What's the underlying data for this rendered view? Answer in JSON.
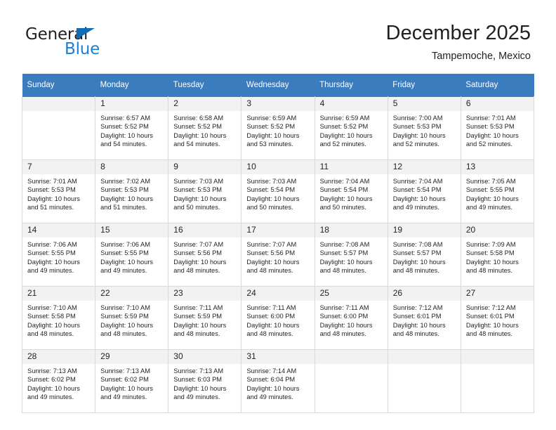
{
  "logo": {
    "word_one": "General",
    "word_two": "Blue",
    "triangle_color": "#0f6cb6",
    "blue_text_color": "#1b7fd4"
  },
  "header": {
    "title": "December 2025",
    "subtitle": "Tampemoche, Mexico"
  },
  "theme": {
    "header_blue": "#3a7cbe",
    "daynum_gray": "#f2f2f2",
    "border_gray": "#d9d9d9",
    "text": "#231f20"
  },
  "weekday_headers": [
    "Sunday",
    "Monday",
    "Tuesday",
    "Wednesday",
    "Thursday",
    "Friday",
    "Saturday"
  ],
  "weeks": [
    [
      {
        "day": "",
        "sunrise": "",
        "sunset": "",
        "daylight_line1": "",
        "daylight_line2": ""
      },
      {
        "day": "1",
        "sunrise": "Sunrise: 6:57 AM",
        "sunset": "Sunset: 5:52 PM",
        "daylight_line1": "Daylight: 10 hours",
        "daylight_line2": "and 54 minutes."
      },
      {
        "day": "2",
        "sunrise": "Sunrise: 6:58 AM",
        "sunset": "Sunset: 5:52 PM",
        "daylight_line1": "Daylight: 10 hours",
        "daylight_line2": "and 54 minutes."
      },
      {
        "day": "3",
        "sunrise": "Sunrise: 6:59 AM",
        "sunset": "Sunset: 5:52 PM",
        "daylight_line1": "Daylight: 10 hours",
        "daylight_line2": "and 53 minutes."
      },
      {
        "day": "4",
        "sunrise": "Sunrise: 6:59 AM",
        "sunset": "Sunset: 5:52 PM",
        "daylight_line1": "Daylight: 10 hours",
        "daylight_line2": "and 52 minutes."
      },
      {
        "day": "5",
        "sunrise": "Sunrise: 7:00 AM",
        "sunset": "Sunset: 5:53 PM",
        "daylight_line1": "Daylight: 10 hours",
        "daylight_line2": "and 52 minutes."
      },
      {
        "day": "6",
        "sunrise": "Sunrise: 7:01 AM",
        "sunset": "Sunset: 5:53 PM",
        "daylight_line1": "Daylight: 10 hours",
        "daylight_line2": "and 52 minutes."
      }
    ],
    [
      {
        "day": "7",
        "sunrise": "Sunrise: 7:01 AM",
        "sunset": "Sunset: 5:53 PM",
        "daylight_line1": "Daylight: 10 hours",
        "daylight_line2": "and 51 minutes."
      },
      {
        "day": "8",
        "sunrise": "Sunrise: 7:02 AM",
        "sunset": "Sunset: 5:53 PM",
        "daylight_line1": "Daylight: 10 hours",
        "daylight_line2": "and 51 minutes."
      },
      {
        "day": "9",
        "sunrise": "Sunrise: 7:03 AM",
        "sunset": "Sunset: 5:53 PM",
        "daylight_line1": "Daylight: 10 hours",
        "daylight_line2": "and 50 minutes."
      },
      {
        "day": "10",
        "sunrise": "Sunrise: 7:03 AM",
        "sunset": "Sunset: 5:54 PM",
        "daylight_line1": "Daylight: 10 hours",
        "daylight_line2": "and 50 minutes."
      },
      {
        "day": "11",
        "sunrise": "Sunrise: 7:04 AM",
        "sunset": "Sunset: 5:54 PM",
        "daylight_line1": "Daylight: 10 hours",
        "daylight_line2": "and 50 minutes."
      },
      {
        "day": "12",
        "sunrise": "Sunrise: 7:04 AM",
        "sunset": "Sunset: 5:54 PM",
        "daylight_line1": "Daylight: 10 hours",
        "daylight_line2": "and 49 minutes."
      },
      {
        "day": "13",
        "sunrise": "Sunrise: 7:05 AM",
        "sunset": "Sunset: 5:55 PM",
        "daylight_line1": "Daylight: 10 hours",
        "daylight_line2": "and 49 minutes."
      }
    ],
    [
      {
        "day": "14",
        "sunrise": "Sunrise: 7:06 AM",
        "sunset": "Sunset: 5:55 PM",
        "daylight_line1": "Daylight: 10 hours",
        "daylight_line2": "and 49 minutes."
      },
      {
        "day": "15",
        "sunrise": "Sunrise: 7:06 AM",
        "sunset": "Sunset: 5:55 PM",
        "daylight_line1": "Daylight: 10 hours",
        "daylight_line2": "and 49 minutes."
      },
      {
        "day": "16",
        "sunrise": "Sunrise: 7:07 AM",
        "sunset": "Sunset: 5:56 PM",
        "daylight_line1": "Daylight: 10 hours",
        "daylight_line2": "and 48 minutes."
      },
      {
        "day": "17",
        "sunrise": "Sunrise: 7:07 AM",
        "sunset": "Sunset: 5:56 PM",
        "daylight_line1": "Daylight: 10 hours",
        "daylight_line2": "and 48 minutes."
      },
      {
        "day": "18",
        "sunrise": "Sunrise: 7:08 AM",
        "sunset": "Sunset: 5:57 PM",
        "daylight_line1": "Daylight: 10 hours",
        "daylight_line2": "and 48 minutes."
      },
      {
        "day": "19",
        "sunrise": "Sunrise: 7:08 AM",
        "sunset": "Sunset: 5:57 PM",
        "daylight_line1": "Daylight: 10 hours",
        "daylight_line2": "and 48 minutes."
      },
      {
        "day": "20",
        "sunrise": "Sunrise: 7:09 AM",
        "sunset": "Sunset: 5:58 PM",
        "daylight_line1": "Daylight: 10 hours",
        "daylight_line2": "and 48 minutes."
      }
    ],
    [
      {
        "day": "21",
        "sunrise": "Sunrise: 7:10 AM",
        "sunset": "Sunset: 5:58 PM",
        "daylight_line1": "Daylight: 10 hours",
        "daylight_line2": "and 48 minutes."
      },
      {
        "day": "22",
        "sunrise": "Sunrise: 7:10 AM",
        "sunset": "Sunset: 5:59 PM",
        "daylight_line1": "Daylight: 10 hours",
        "daylight_line2": "and 48 minutes."
      },
      {
        "day": "23",
        "sunrise": "Sunrise: 7:11 AM",
        "sunset": "Sunset: 5:59 PM",
        "daylight_line1": "Daylight: 10 hours",
        "daylight_line2": "and 48 minutes."
      },
      {
        "day": "24",
        "sunrise": "Sunrise: 7:11 AM",
        "sunset": "Sunset: 6:00 PM",
        "daylight_line1": "Daylight: 10 hours",
        "daylight_line2": "and 48 minutes."
      },
      {
        "day": "25",
        "sunrise": "Sunrise: 7:11 AM",
        "sunset": "Sunset: 6:00 PM",
        "daylight_line1": "Daylight: 10 hours",
        "daylight_line2": "and 48 minutes."
      },
      {
        "day": "26",
        "sunrise": "Sunrise: 7:12 AM",
        "sunset": "Sunset: 6:01 PM",
        "daylight_line1": "Daylight: 10 hours",
        "daylight_line2": "and 48 minutes."
      },
      {
        "day": "27",
        "sunrise": "Sunrise: 7:12 AM",
        "sunset": "Sunset: 6:01 PM",
        "daylight_line1": "Daylight: 10 hours",
        "daylight_line2": "and 48 minutes."
      }
    ],
    [
      {
        "day": "28",
        "sunrise": "Sunrise: 7:13 AM",
        "sunset": "Sunset: 6:02 PM",
        "daylight_line1": "Daylight: 10 hours",
        "daylight_line2": "and 49 minutes."
      },
      {
        "day": "29",
        "sunrise": "Sunrise: 7:13 AM",
        "sunset": "Sunset: 6:02 PM",
        "daylight_line1": "Daylight: 10 hours",
        "daylight_line2": "and 49 minutes."
      },
      {
        "day": "30",
        "sunrise": "Sunrise: 7:13 AM",
        "sunset": "Sunset: 6:03 PM",
        "daylight_line1": "Daylight: 10 hours",
        "daylight_line2": "and 49 minutes."
      },
      {
        "day": "31",
        "sunrise": "Sunrise: 7:14 AM",
        "sunset": "Sunset: 6:04 PM",
        "daylight_line1": "Daylight: 10 hours",
        "daylight_line2": "and 49 minutes."
      },
      {
        "day": "",
        "sunrise": "",
        "sunset": "",
        "daylight_line1": "",
        "daylight_line2": ""
      },
      {
        "day": "",
        "sunrise": "",
        "sunset": "",
        "daylight_line1": "",
        "daylight_line2": ""
      },
      {
        "day": "",
        "sunrise": "",
        "sunset": "",
        "daylight_line1": "",
        "daylight_line2": ""
      }
    ]
  ]
}
